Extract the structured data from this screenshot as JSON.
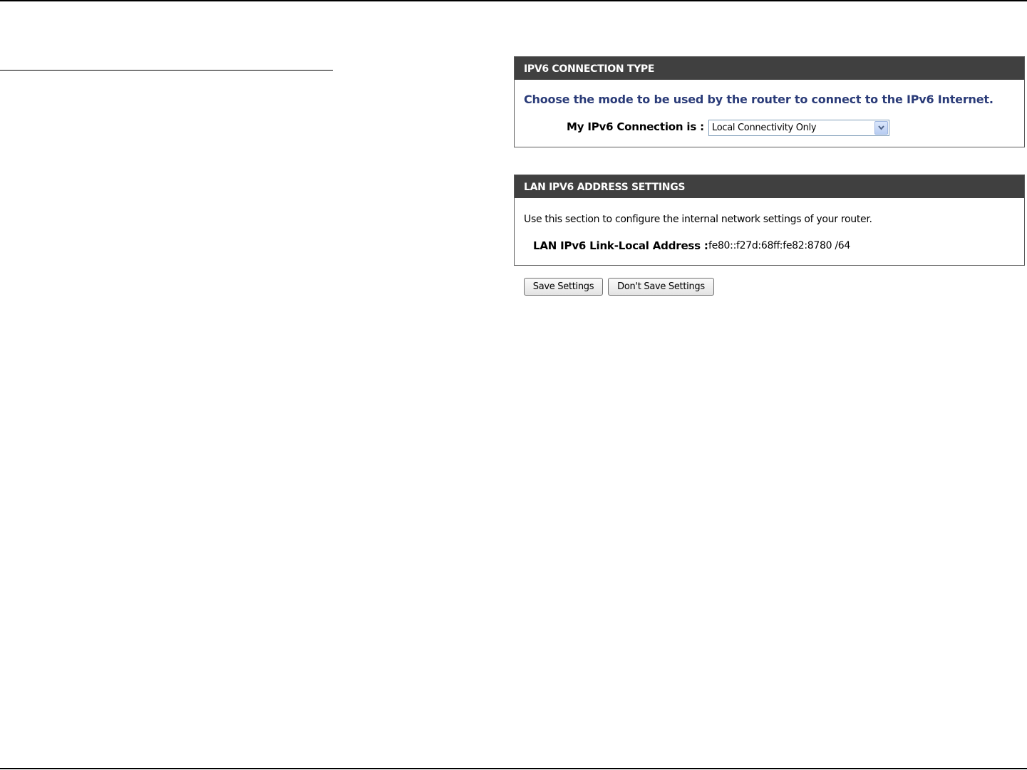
{
  "connection_panel": {
    "header": "IPV6 CONNECTION TYPE",
    "intro": "Choose the mode to be used by the router to connect to the IPv6 Internet.",
    "connection_label": "My IPv6 Connection is :",
    "connection_value": "Local Connectivity Only"
  },
  "lan_panel": {
    "header": "LAN IPV6 ADDRESS SETTINGS",
    "intro": "Use this section to configure the internal network settings of your router.",
    "address_label": "LAN IPv6 Link-Local Address :",
    "address_value": "fe80::f27d:68ff:fe82:8780 /64"
  },
  "buttons": {
    "save_label": "Save Settings",
    "dont_save_label": "Don't Save Settings"
  },
  "icons": {
    "dropdown": "chevron-down-icon"
  },
  "colors": {
    "header_bg": "#404040",
    "intro_text": "#2a3b78"
  }
}
